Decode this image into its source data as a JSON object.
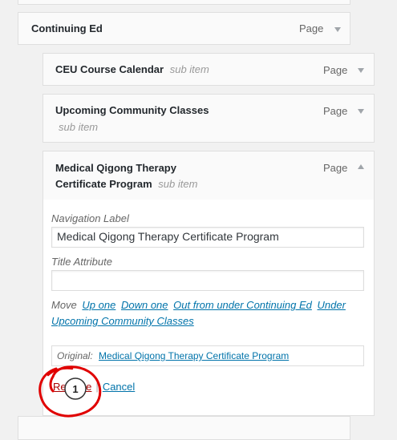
{
  "parent": {
    "title": "Continuing Ed",
    "type": "Page"
  },
  "items": [
    {
      "title": "CEU Course Calendar",
      "sub": "sub item",
      "type": "Page"
    },
    {
      "title": "Upcoming Community Classes",
      "sub": "sub item",
      "type": "Page"
    }
  ],
  "open_item": {
    "title_line1": "Medical Qigong Therapy",
    "title_line2": "Certificate Program",
    "sub": "sub item",
    "type": "Page"
  },
  "settings": {
    "nav_label": "Navigation Label",
    "nav_value": "Medical Qigong Therapy Certificate Program",
    "title_attr_label": "Title Attribute",
    "title_attr_value": "",
    "move_label": "Move",
    "move_up": "Up one",
    "move_down": "Down one",
    "move_out": "Out from under Continuing Ed",
    "move_under": "Under",
    "move_under_target": "Upcoming Community Classes",
    "original_label": "Original:",
    "original_link": "Medical Qigong Therapy Certificate Program",
    "remove": "Remove",
    "separator": "|",
    "cancel": "Cancel"
  },
  "annotation": {
    "number": "1",
    "color": "#e00000"
  }
}
